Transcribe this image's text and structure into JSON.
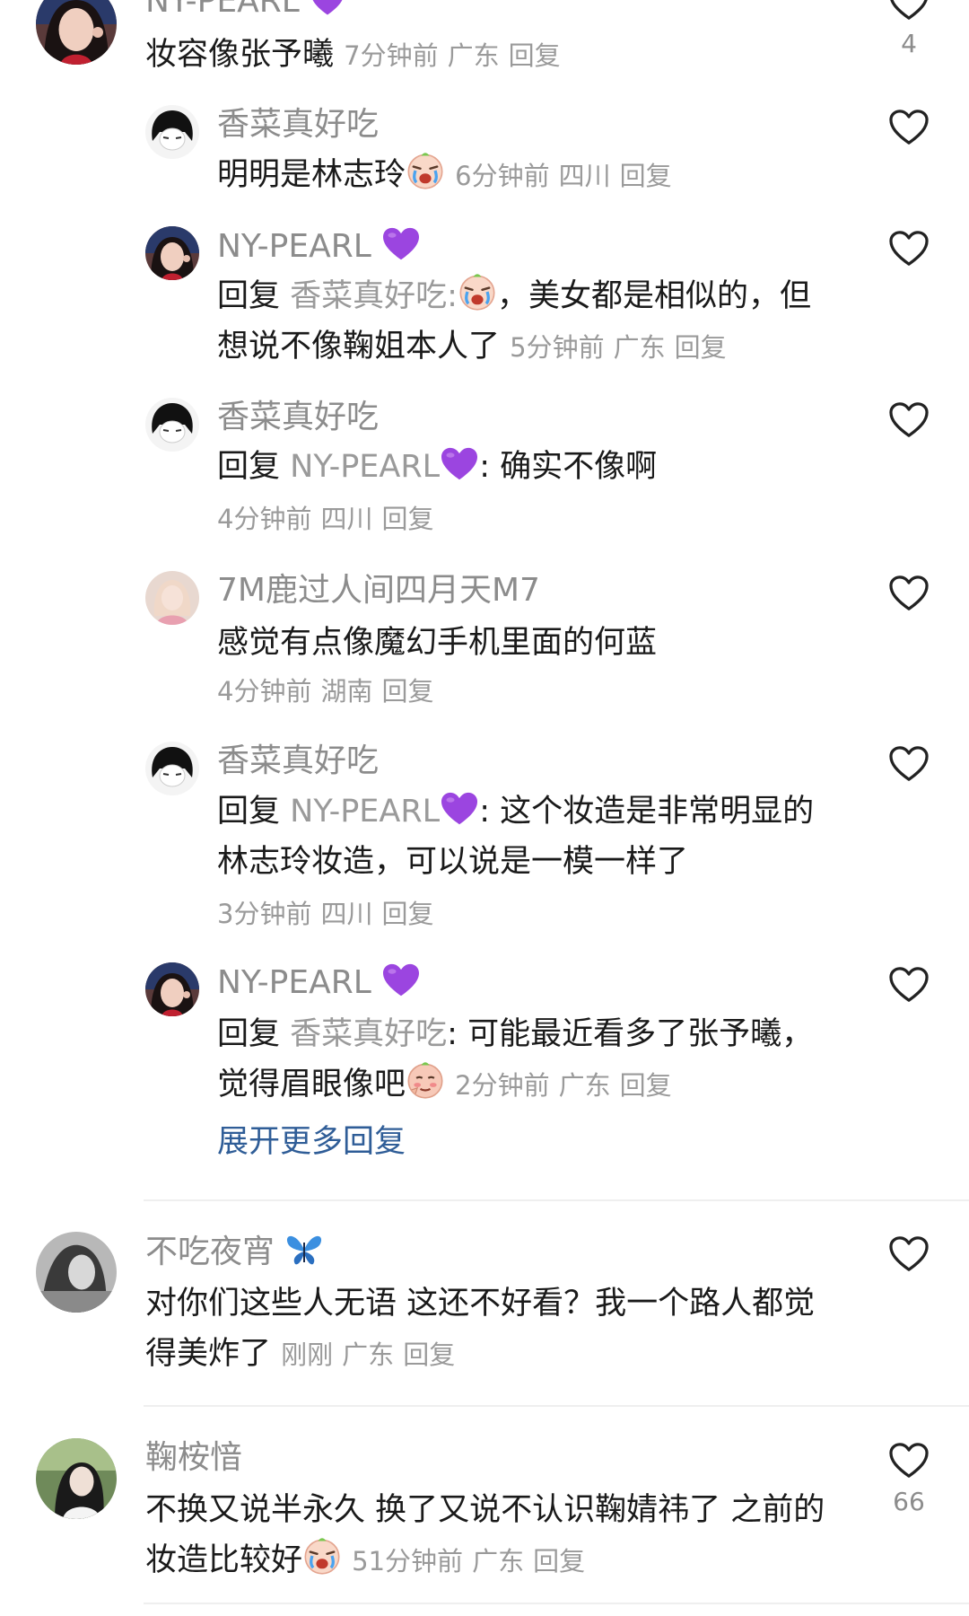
{
  "comments": [
    {
      "user": "NY-PEARL",
      "text": "妆容像张予曦",
      "time": "7分钟前",
      "location": "广东",
      "reply": "回复",
      "likes": "4"
    },
    {
      "user": "香菜真好吃",
      "text": "明明是林志玲",
      "time": "6分钟前",
      "location": "四川",
      "reply": "回复"
    },
    {
      "user": "NY-PEARL",
      "reply_prefix": "回复",
      "reply_to": "香菜真好吃:",
      "text_line1": "，美女都是相似的，但",
      "text_line2": "想说不像鞠姐本人了",
      "time": "5分钟前",
      "location": "广东",
      "reply": "回复"
    },
    {
      "user": "香菜真好吃",
      "reply_prefix": "回复",
      "reply_to": "NY-PEARL",
      "text": ": 确实不像啊",
      "time": "4分钟前",
      "location": "四川",
      "reply": "回复"
    },
    {
      "user": "7M鹿过人间四月天M7",
      "text": "感觉有点像魔幻手机里面的何蓝",
      "time": "4分钟前",
      "location": "湖南",
      "reply": "回复"
    },
    {
      "user": "香菜真好吃",
      "reply_prefix": "回复",
      "reply_to": "NY-PEARL",
      "text_line1": ": 这个妆造是非常明显的",
      "text_line2": "林志玲妆造，可以说是一模一样了",
      "time": "3分钟前",
      "location": "四川",
      "reply": "回复"
    },
    {
      "user": "NY-PEARL",
      "reply_prefix": "回复",
      "reply_to": "香菜真好吃",
      "text_line1": ": 可能最近看多了张予曦，",
      "text_line2": "觉得眉眼像吧",
      "time": "2分钟前",
      "location": "广东",
      "reply": "回复"
    },
    {
      "user": "不吃夜宵",
      "text_line1": "对你们这些人无语 这还不好看？我一个路人都觉",
      "text_line2": "得美炸了",
      "time": "刚刚",
      "location": "广东",
      "reply": "回复"
    },
    {
      "user": "鞠桉愔",
      "text_line1": "不换又说半永久 换了又说不认识鞠婧祎了 之前的",
      "text_line2": "妆造比较好",
      "time": "51分钟前",
      "location": "广东",
      "reply": "回复",
      "likes": "66"
    }
  ],
  "expand_replies": "展开更多回复",
  "colors": {
    "link": "#2f5d97",
    "heart_purple": "#9b45e0",
    "butterfly": "#3b8fe0",
    "meta": "#9a9a9a"
  }
}
